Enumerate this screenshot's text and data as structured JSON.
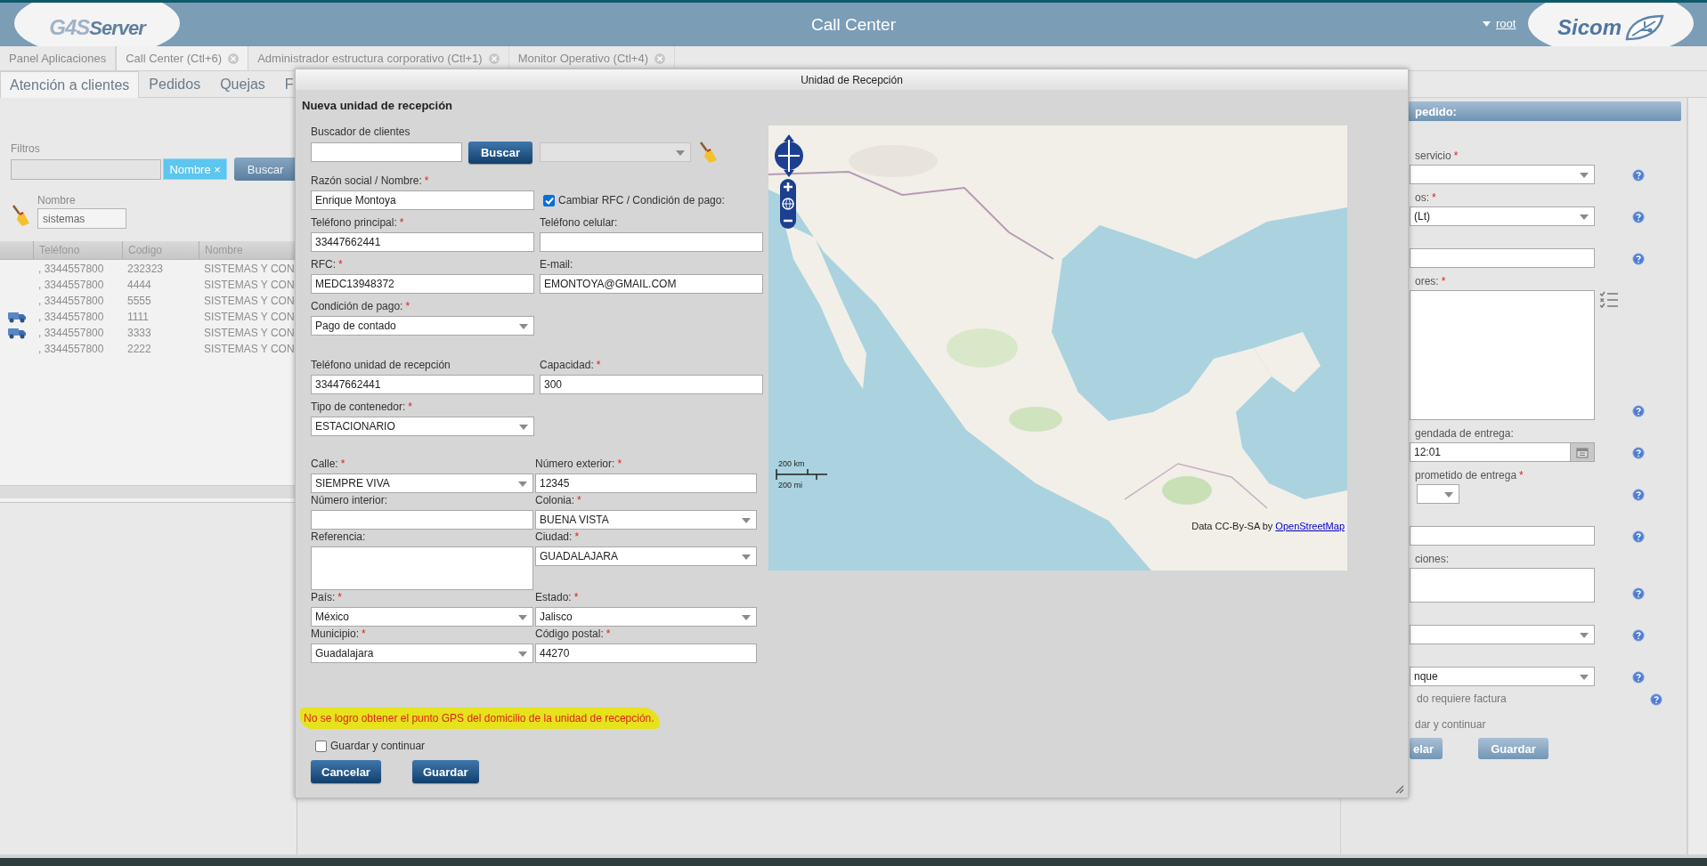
{
  "header": {
    "logo": [
      "G4S",
      "Server"
    ],
    "title": "Call Center",
    "user": "root",
    "brand": "Sicom"
  },
  "app_tabs": [
    {
      "label": "Panel Aplicaciones",
      "selected": false,
      "closable": false
    },
    {
      "label": "Call Center (Ctl+6)",
      "selected": true,
      "closable": true
    },
    {
      "label": "Administrador estructura corporativo (Ctl+1)",
      "selected": false,
      "closable": true
    },
    {
      "label": "Monitor Operativo (Ctl+4)",
      "selected": false,
      "closable": true
    }
  ],
  "sub_tabs": [
    {
      "label": "Atención a clientes",
      "selected": true
    },
    {
      "label": "Pedidos",
      "selected": false
    },
    {
      "label": "Quejas",
      "selected": false
    },
    {
      "label": "F",
      "selected": false
    }
  ],
  "clients": {
    "filters_label": "Filtros",
    "filter_chip": "Nombre ×",
    "search_button": "Buscar",
    "name_label": "Nombre",
    "name_value": "sistemas",
    "columns": [
      "Teléfono",
      "Codigo",
      "Nombre"
    ],
    "rows": [
      {
        "truck": false,
        "phone": ", 3344557800",
        "code": "232323",
        "name": "SISTEMAS Y CON"
      },
      {
        "truck": false,
        "phone": ", 3344557800",
        "code": "4444",
        "name": "SISTEMAS Y CON"
      },
      {
        "truck": false,
        "phone": ", 3344557800",
        "code": "5555",
        "name": "SISTEMAS Y CON"
      },
      {
        "truck": true,
        "phone": ", 3344557800",
        "code": "1111",
        "name": "SISTEMAS Y CON"
      },
      {
        "truck": true,
        "phone": ", 3344557800",
        "code": "3333",
        "name": "SISTEMAS Y CON"
      },
      {
        "truck": false,
        "phone": ", 3344557800",
        "code": "2222",
        "name": "SISTEMAS Y CON"
      }
    ]
  },
  "order": {
    "header": "pedido:",
    "rows": [
      {
        "kind": "select",
        "label": "servicio",
        "mark": "*"
      },
      {
        "kind": "select",
        "label": "os:",
        "mark": "*",
        "value": "(Lt)"
      },
      {
        "kind": "input"
      },
      {
        "kind": "list",
        "label": "ores:",
        "mark": "*"
      },
      {
        "kind": "datetime",
        "label": "gendada de entrega:",
        "value": "12:01"
      },
      {
        "kind": "time",
        "label": "prometido de entrega",
        "mark": "*"
      },
      {
        "kind": "input"
      },
      {
        "kind": "textarea",
        "label": "ciones:"
      },
      {
        "kind": "select"
      },
      {
        "kind": "select",
        "value": "nque"
      },
      {
        "kind": "checkbox",
        "label": "do requiere factura"
      }
    ],
    "continue_label": "dar y continuar",
    "buttons": [
      "elar",
      "Guardar"
    ]
  },
  "dialog": {
    "title": "Unidad de Recepción",
    "heading": "Nueva unidad de recepción",
    "client_search": {
      "label": "Buscador de clientes",
      "button": "Buscar",
      "results_disabled": true
    },
    "sections": [
      {
        "kind": "main",
        "rows": [
          [
            {
              "kind": "input",
              "label": "Razón social / Nombre:",
              "mark": "*",
              "value": "Enrique Montoya"
            },
            {
              "kind": "checkbox",
              "label": "Cambiar RFC / Condición de pago:",
              "checked": true
            }
          ],
          [
            {
              "kind": "input",
              "label": "Teléfono principal:",
              "mark": "*",
              "value": "33447662441"
            },
            {
              "kind": "input",
              "label": "Teléfono celular:"
            }
          ],
          [
            {
              "kind": "input",
              "label": "RFC:",
              "mark": "*",
              "value": "MEDC13948372"
            },
            {
              "kind": "input",
              "label": "E-mail:",
              "value": "EMONTOYA@GMAIL.COM"
            }
          ],
          [
            {
              "kind": "select",
              "label": "Condición de pago:",
              "mark": "*",
              "value": "Pago de contado"
            }
          ]
        ]
      },
      {
        "kind": "main",
        "rows": [
          [
            {
              "kind": "input",
              "label": "Teléfono unidad de recepción",
              "value": "33447662441"
            },
            {
              "kind": "input",
              "label": "Capacidad:",
              "mark": "*",
              "value": "300"
            }
          ],
          [
            {
              "kind": "select",
              "label": "Tipo de contenedor:",
              "mark": "*",
              "value": "ESTACIONARIO"
            }
          ]
        ]
      },
      {
        "kind": "address",
        "rows": [
          [
            {
              "kind": "select",
              "label": "Calle:",
              "mark": "*",
              "value": "SIEMPRE VIVA"
            },
            {
              "kind": "input",
              "label": "Número exterior:",
              "mark": "*",
              "value": "12345"
            }
          ],
          [
            {
              "kind": "input",
              "label": "Número interior:"
            },
            {
              "kind": "select",
              "label": "Colonia:",
              "mark": "*",
              "value": "BUENA VISTA"
            }
          ],
          [
            {
              "kind": "textarea",
              "label": "Referencia:"
            },
            {
              "kind": "select",
              "label": "Ciudad:",
              "mark": "*",
              "value": "GUADALAJARA"
            }
          ],
          [
            {
              "kind": "select",
              "label": "País:",
              "mark": "*",
              "value": "México"
            },
            {
              "kind": "select",
              "label": "Estado:",
              "mark": "*",
              "value": "Jalisco"
            }
          ],
          [
            {
              "kind": "select",
              "label": "Municipio:",
              "mark": "*",
              "value": "Guadalajara"
            },
            {
              "kind": "input",
              "label": "Código postal:",
              "mark": "*",
              "value": "44270"
            }
          ]
        ]
      }
    ],
    "warning": "No se logro obtener el punto GPS del domicilio de la unidad de recepción.",
    "continue": {
      "label": "Guardar y continuar",
      "checked": false
    },
    "buttons": [
      "Cancelar",
      "Guardar"
    ],
    "map": {
      "kind": "picture",
      "scale": [
        "200 km",
        "200 mi"
      ],
      "attribution": "Data CC-By-SA by",
      "attribution_link": "OpenStreetMap"
    }
  }
}
